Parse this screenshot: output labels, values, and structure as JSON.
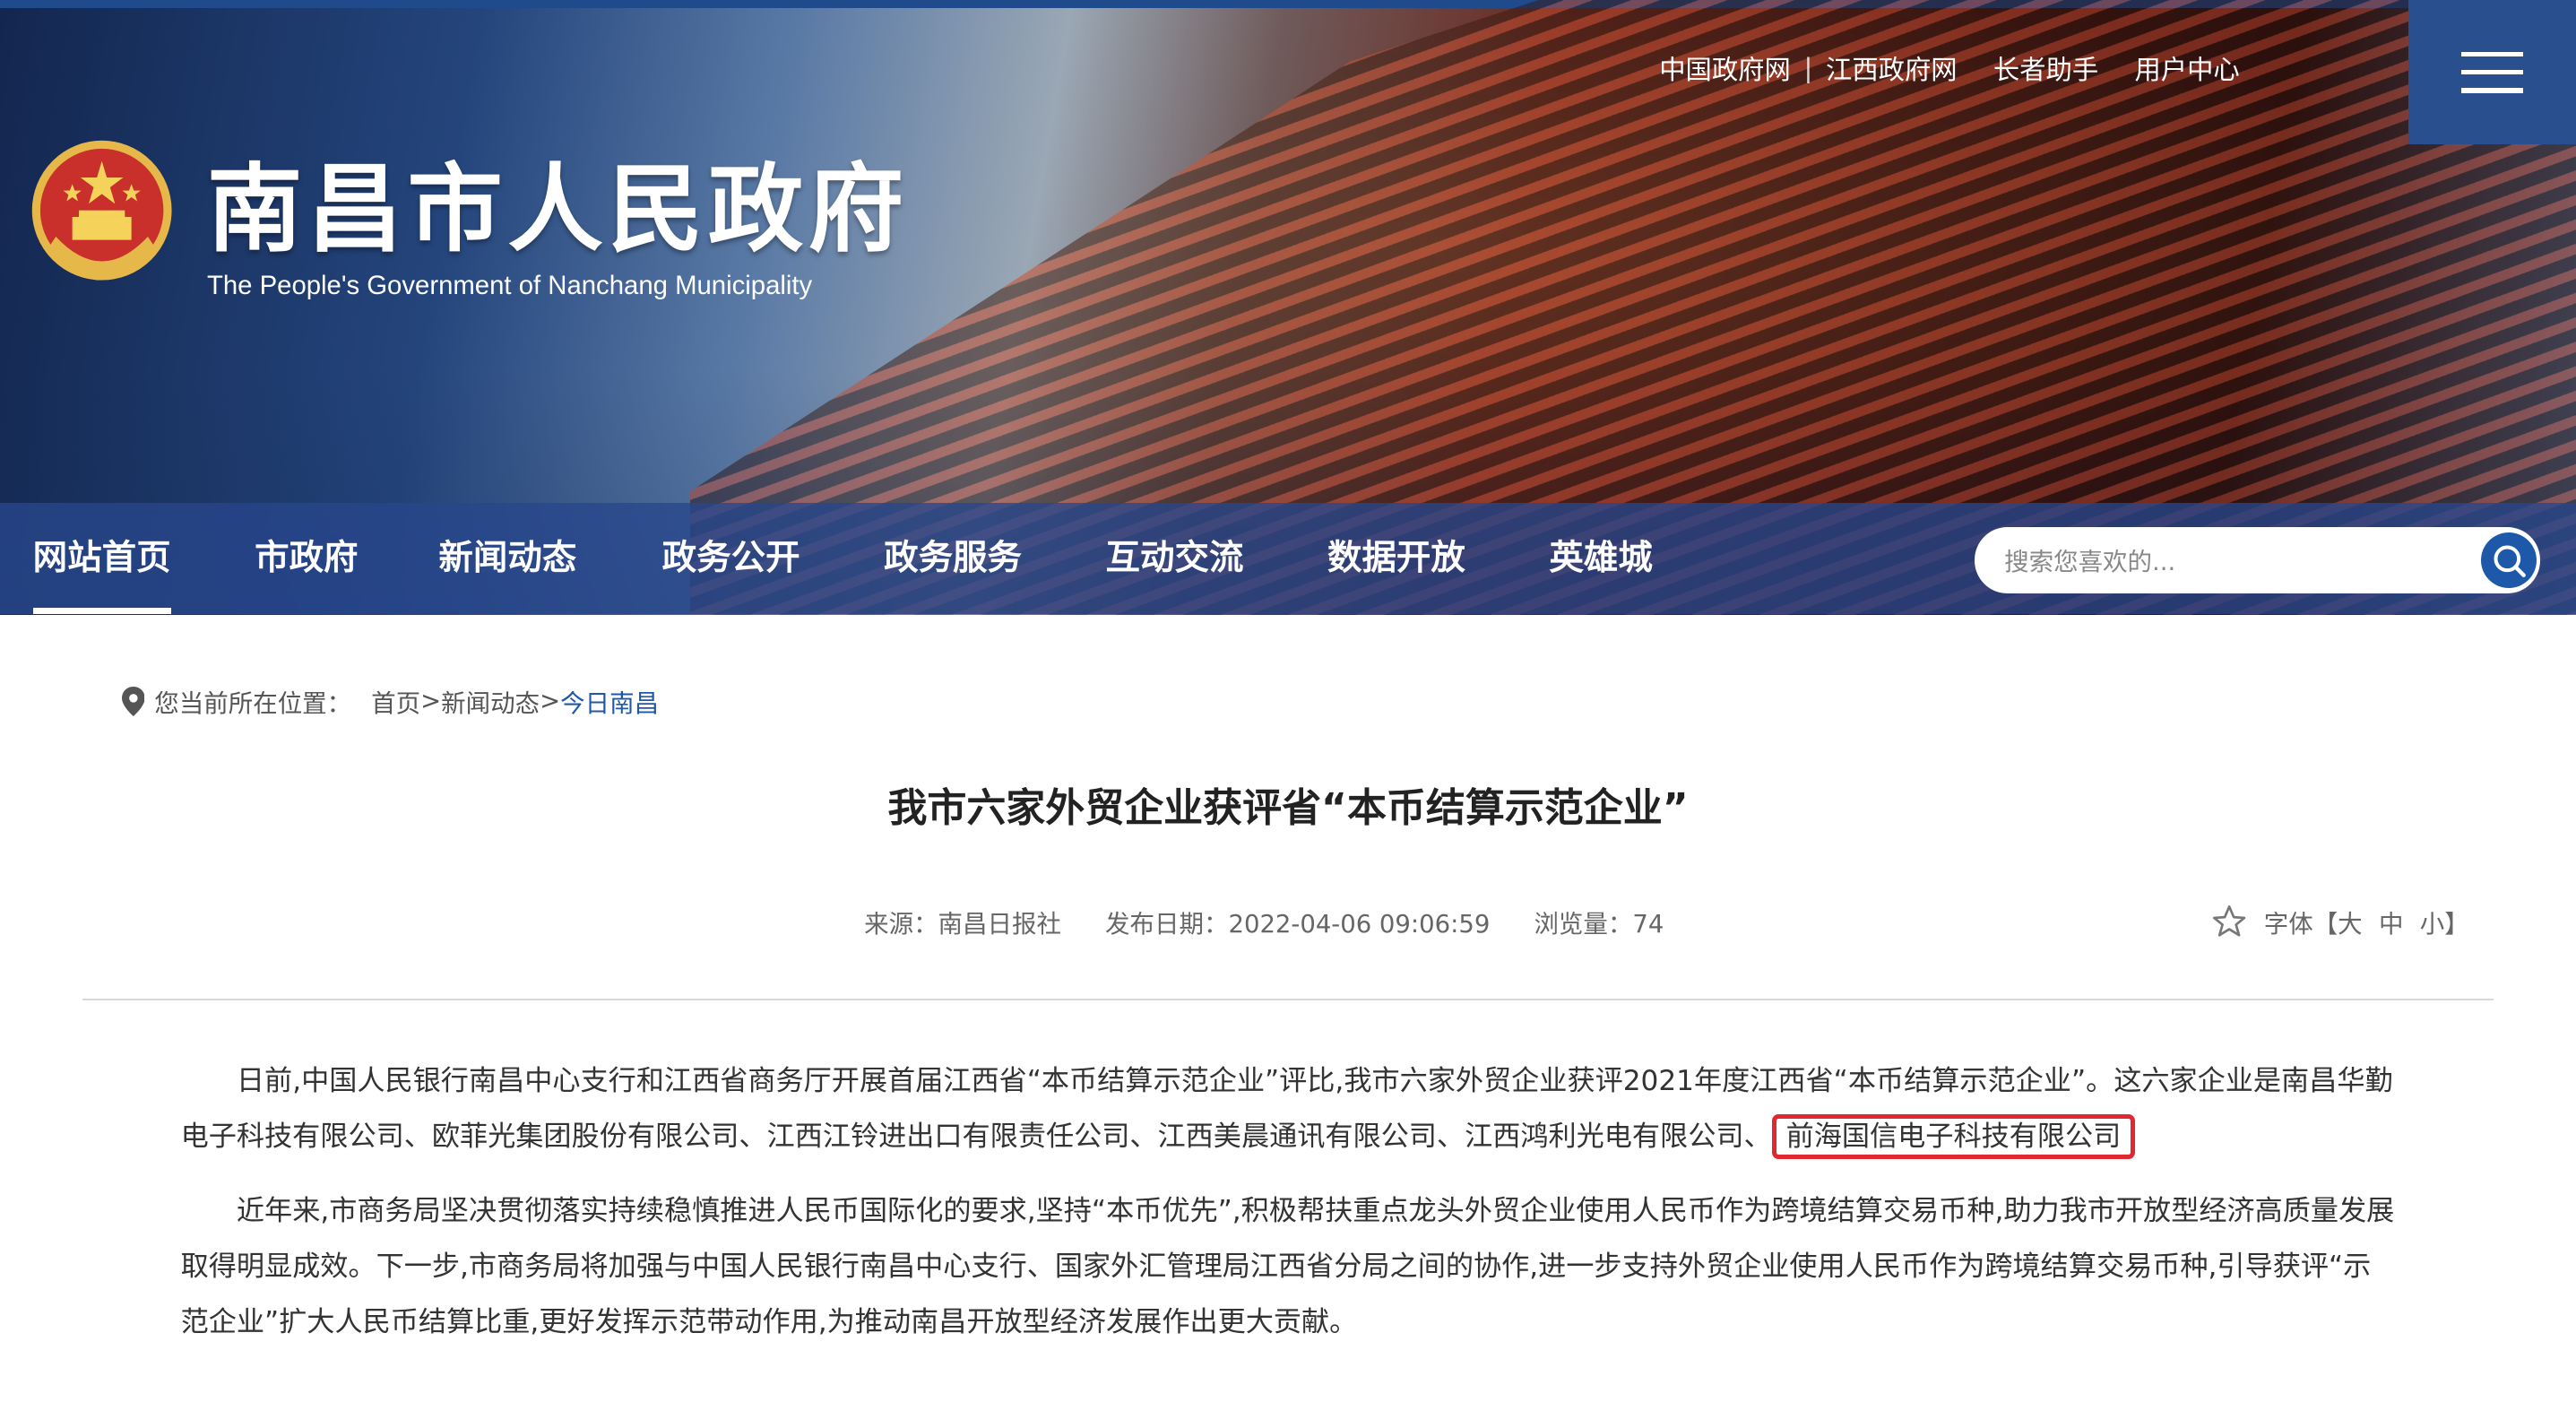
{
  "header": {
    "site_title": "南昌市人民政府",
    "site_subtitle": "The People's Government of Nanchang Municipality",
    "top_links": [
      "中国政府网",
      "江西政府网",
      "长者助手",
      "用户中心"
    ],
    "emblem_icon": "national-emblem-icon",
    "menu_icon": "hamburger-menu-icon"
  },
  "nav": {
    "items": [
      "网站首页",
      "市政府",
      "新闻动态",
      "政务公开",
      "政务服务",
      "互动交流",
      "数据开放",
      "英雄城"
    ],
    "active_index": 0,
    "search_placeholder": "搜索您喜欢的..."
  },
  "breadcrumb": {
    "prefix": "您当前所在位置：",
    "home": "首页",
    "sep1": ">",
    "level1": "新闻动态",
    "sep2": ">",
    "current": "今日南昌",
    "icon": "location-pin-icon"
  },
  "article": {
    "title": "我市六家外贸企业获评省“本币结算示范企业”",
    "source": "来源：南昌日报社",
    "date": "发布日期：2022-04-06 09:06:59",
    "views": "浏览量：74",
    "font_label": "字体【大",
    "font_mid": "中",
    "font_small": "小】",
    "star_icon": "star-outline-icon",
    "p1_text": "日前,中国人民银行南昌中心支行和江西省商务厅开展首届江西省“本币结算示范企业”评比,我市六家外贸企业获评2021年度江西省“本币结算示范企业”。这六家企业是南昌华勤电子科技有限公司、欧菲光集团股份有限公司、江西江铃进出口有限责任公司、江西美晨通讯有限公司、江西鸿利光电有限公司、",
    "p1_highlight": "前海国信电子科技有限公司",
    "p2_text": "近年来,市商务局坚决贯彻落实持续稳慎推进人民币国际化的要求,坚持“本币优先”,积极帮扶重点龙头外贸企业使用人民币作为跨境结算交易币种,助力我市开放型经济高质量发展取得明显成效。下一步,市商务局将加强与中国人民银行南昌中心支行、国家外汇管理局江西省分局之间的协作,进一步支持外贸企业使用人民币作为跨境结算交易币种,引导获评“示范企业”扩大人民币结算比重,更好发挥示范带动作用,为推动南昌开放型经济发展作出更大贡献。"
  },
  "colors": {
    "nav_bg": "#2a4f8f",
    "accent": "#1d59a8",
    "highlight_border": "#e0282e"
  }
}
